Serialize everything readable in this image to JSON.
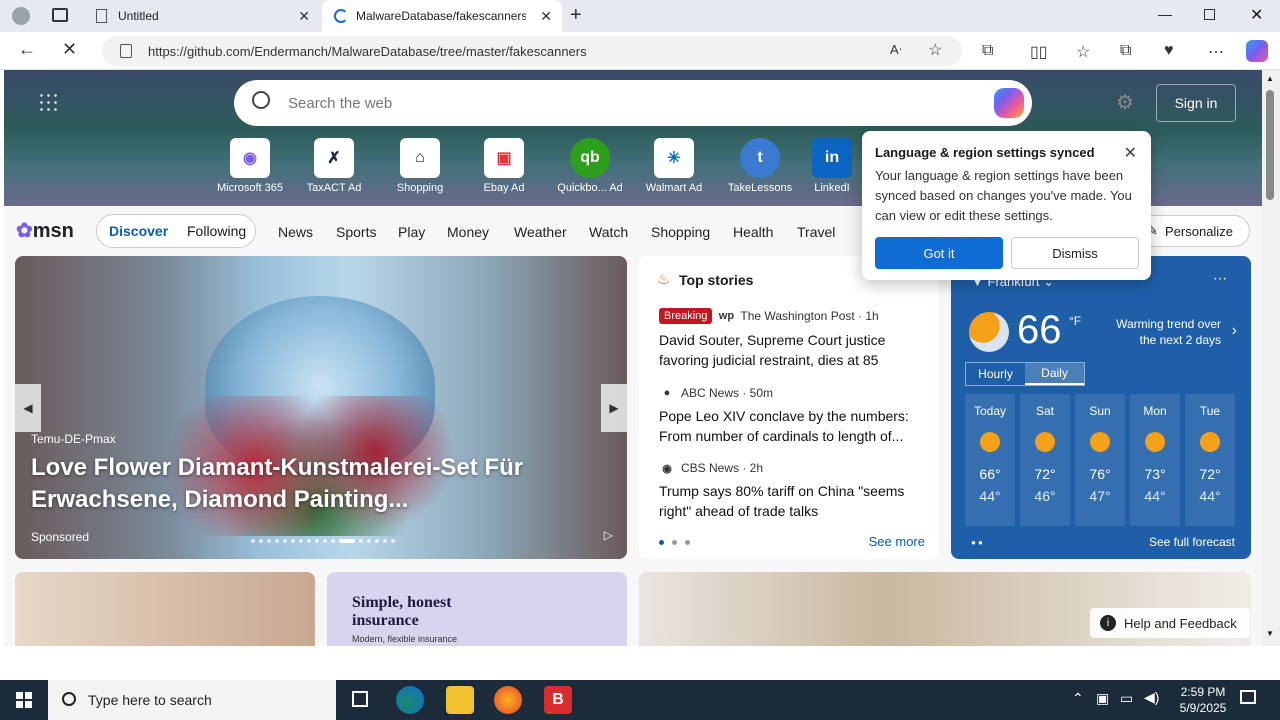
{
  "browser": {
    "tabs": [
      {
        "title": "Untitled"
      },
      {
        "title": "MalwareDatabase/fakescanners a"
      }
    ],
    "url": "https://github.com/Endermanch/MalwareDatabase/tree/master/fakescanners"
  },
  "msn": {
    "search_placeholder": "Search the web",
    "signin": "Sign in",
    "quicklinks": [
      {
        "label": "Microsoft 365",
        "ad": ""
      },
      {
        "label": "TaxACT",
        "ad": "Ad"
      },
      {
        "label": "Shopping",
        "ad": ""
      },
      {
        "label": "Ebay",
        "ad": "Ad"
      },
      {
        "label": "Quickbo...",
        "ad": "Ad"
      },
      {
        "label": "Walmart",
        "ad": "Ad"
      },
      {
        "label": "TakeLessons",
        "ad": ""
      },
      {
        "label": "LinkedI",
        "ad": ""
      }
    ],
    "logo": "msn",
    "nav": {
      "discover": "Discover",
      "following": "Following",
      "items": [
        "News",
        "Sports",
        "Play",
        "Money",
        "Weather",
        "Watch",
        "Shopping",
        "Health",
        "Travel"
      ],
      "personalize": "Personalize"
    },
    "carousel": {
      "sponsor": "Temu-DE-Pmax",
      "title": "Love Flower Diamant-Kunstmalerei-Set Für Erwachsene, Diamond Painting...",
      "label": "Sponsored"
    },
    "top_stories": {
      "heading": "Top stories",
      "stories": [
        {
          "badge": "Breaking",
          "source": "The Washington Post · 1h",
          "headline": "David Souter, Supreme Court justice favoring judicial restraint, dies at 85"
        },
        {
          "badge": "",
          "source": "ABC News · 50m",
          "headline": "Pope Leo XIV conclave by the numbers: From number of cardinals to length of..."
        },
        {
          "badge": "",
          "source": "CBS News · 2h",
          "headline": "Trump says 80% tariff on China \"seems right\" ahead of trade talks"
        }
      ],
      "see_more": "See more"
    },
    "weather": {
      "city": "Frankfurt",
      "temp": "66",
      "unit": "°F",
      "trend": "Warming trend over the next 2 days",
      "tabs": [
        "Hourly",
        "Daily"
      ],
      "days": [
        {
          "name": "Today",
          "hi": "66°",
          "lo": "44°"
        },
        {
          "name": "Sat",
          "hi": "72°",
          "lo": "46°"
        },
        {
          "name": "Sun",
          "hi": "76°",
          "lo": "47°"
        },
        {
          "name": "Mon",
          "hi": "73°",
          "lo": "44°"
        },
        {
          "name": "Tue",
          "hi": "72°",
          "lo": "44°"
        }
      ],
      "forecast_link": "See full forecast"
    },
    "card2": {
      "title": "Simple, honest insurance",
      "sub": "Modern, flexible insurance"
    },
    "help": "Help and Feedback"
  },
  "popup": {
    "title": "Language & region settings synced",
    "body": "Your language & region settings have been synced based on changes you've made. You can view or edit these settings.",
    "got_it": "Got it",
    "dismiss": "Dismiss"
  },
  "taskbar": {
    "search_placeholder": "Type here to search",
    "time": "2:59 PM",
    "date": "5/9/2025"
  },
  "colors": {
    "accent": "#0f6cd4",
    "weather_bg": "#1f5fa8",
    "breaking": "#c4161c"
  }
}
